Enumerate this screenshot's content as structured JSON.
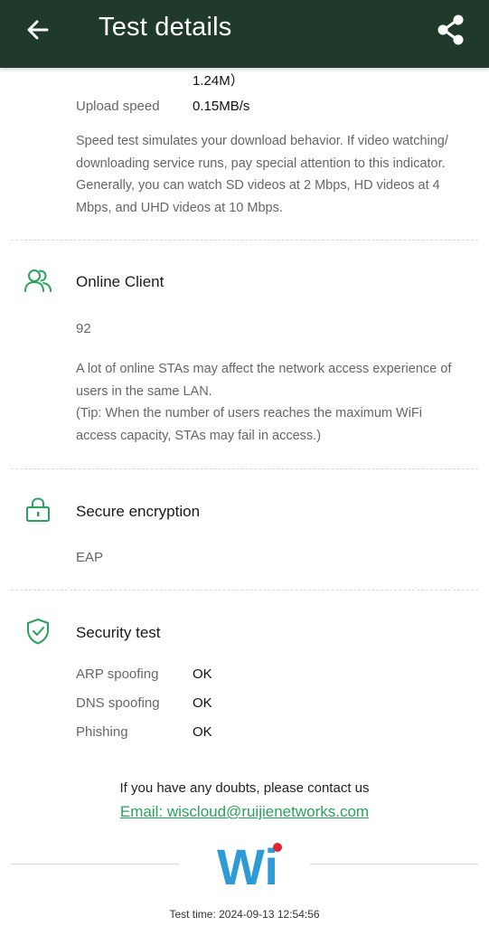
{
  "header": {
    "title": "Test details",
    "back_icon": "arrow-left-icon",
    "share_icon": "share-icon",
    "background": "#1f3a2a"
  },
  "speed": {
    "download_tail": "1.24M）",
    "upload_label": "Upload speed",
    "upload_value": "0.15MB/s",
    "description": "Speed test simulates your download behavior. If video watching/ downloading service runs, pay special attention to this indicator. Generally, you can watch SD videos at 2 Mbps, HD videos at 4 Mbps, and UHD videos at 10 Mbps."
  },
  "online_client": {
    "title": "Online Client",
    "icon": "users-icon",
    "value": "92",
    "description": "A lot of online STAs may affect the network access experience of users in the same LAN.",
    "tip": "(Tip: When the number of users reaches the maximum WiFi access capacity, STAs may fail in access.)"
  },
  "encryption": {
    "title": "Secure encryption",
    "icon": "lock-icon",
    "value": "EAP"
  },
  "security": {
    "title": "Security test",
    "icon": "shield-check-icon",
    "rows": [
      {
        "label": "ARP spoofing",
        "value": "OK"
      },
      {
        "label": "DNS spoofing",
        "value": "OK"
      },
      {
        "label": "Phishing",
        "value": "OK"
      }
    ]
  },
  "footer": {
    "contact_text": "If you have any doubts, please contact us",
    "email_text": "Email: wiscloud@ruijienetworks.com",
    "logo_text": "Wi",
    "test_time": "Test time: 2024-09-13 12:54:56"
  },
  "colors": {
    "accent_green": "#27a35c",
    "logo_blue": "#2f9bd6",
    "logo_red": "#e3232f"
  }
}
